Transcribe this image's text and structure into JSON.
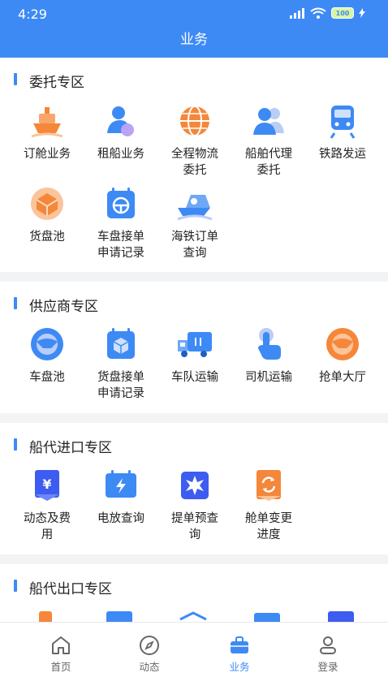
{
  "status_bar": {
    "time": "4:29",
    "battery": "100"
  },
  "header": {
    "title": "业务"
  },
  "sections": [
    {
      "title": "委托专区",
      "items": [
        {
          "label": "订舱业务",
          "icon": "ship-icon"
        },
        {
          "label": "租船业务",
          "icon": "person-icon"
        },
        {
          "label": "全程物流\n委托",
          "icon": "globe-icon"
        },
        {
          "label": "船舶代理\n委托",
          "icon": "agents-icon"
        },
        {
          "label": "铁路发运",
          "icon": "train-icon"
        },
        {
          "label": "货盘池",
          "icon": "cargo-box-icon"
        },
        {
          "label": "车盘接单\n申请记录",
          "icon": "steering-calendar-icon"
        },
        {
          "label": "海铁订单\n查询",
          "icon": "ship-rail-icon"
        }
      ]
    },
    {
      "title": "供应商专区",
      "items": [
        {
          "label": "车盘池",
          "icon": "steering-wheel-icon"
        },
        {
          "label": "货盘接单\n申请记录",
          "icon": "box-calendar-icon"
        },
        {
          "label": "车队运输",
          "icon": "truck-icon"
        },
        {
          "label": "司机运输",
          "icon": "tap-hand-icon"
        },
        {
          "label": "抢单大厅",
          "icon": "steering-orange-icon"
        }
      ]
    },
    {
      "title": "船代进口专区",
      "items": [
        {
          "label": "动态及费\n用",
          "icon": "yen-document-icon"
        },
        {
          "label": "电放查询",
          "icon": "lightning-calendar-icon"
        },
        {
          "label": "提单预查\n询",
          "icon": "star-burst-icon"
        },
        {
          "label": "舱单变更\n进度",
          "icon": "refresh-document-icon"
        }
      ]
    },
    {
      "title": "船代出口专区",
      "items": []
    }
  ],
  "tabbar": [
    {
      "label": "首页",
      "icon": "home-icon"
    },
    {
      "label": "动态",
      "icon": "compass-icon"
    },
    {
      "label": "业务",
      "icon": "briefcase-icon",
      "active": true
    },
    {
      "label": "登录",
      "icon": "user-icon"
    }
  ],
  "colors": {
    "primary": "#3d8af5",
    "orange": "#f5873a"
  }
}
